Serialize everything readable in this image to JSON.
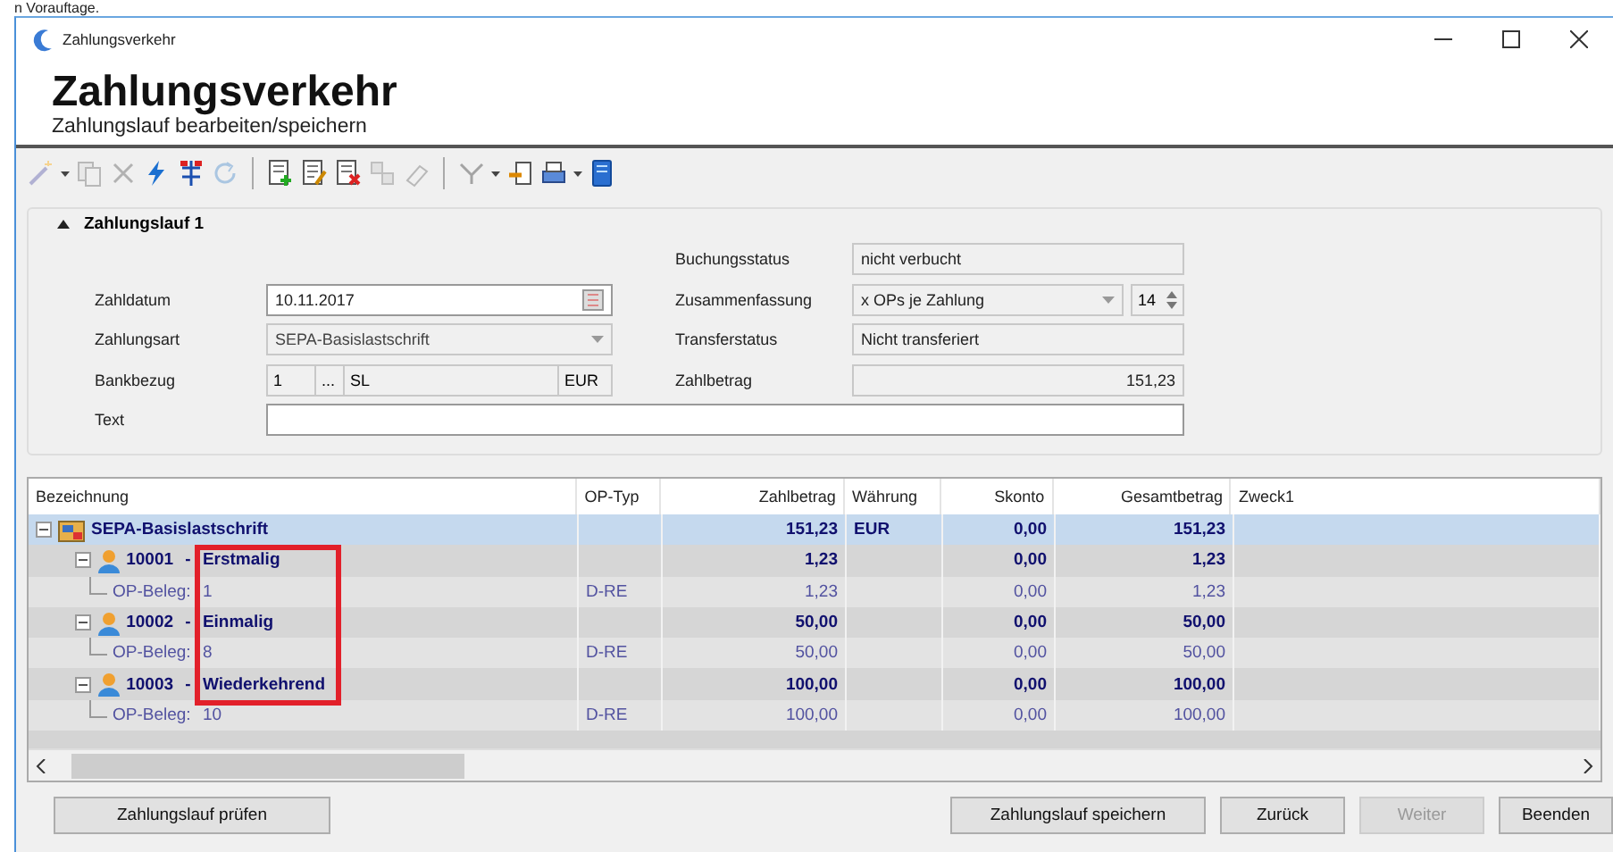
{
  "above_text": "n Vorauftage.",
  "window": {
    "title": "Zahlungsverkehr"
  },
  "header": {
    "title": "Zahlungsverkehr",
    "subtitle": "Zahlungslauf bearbeiten/speichern"
  },
  "toolbar": [
    {
      "kind": "wand",
      "disabled": true,
      "dropdown": true
    },
    {
      "kind": "copy",
      "disabled": true
    },
    {
      "kind": "cross",
      "disabled": true
    },
    {
      "kind": "bolt",
      "disabled": false
    },
    {
      "kind": "split",
      "disabled": false
    },
    {
      "kind": "refresh",
      "disabled": true
    },
    {
      "kind": "separator"
    },
    {
      "kind": "add",
      "disabled": false
    },
    {
      "kind": "edit",
      "disabled": false
    },
    {
      "kind": "remove",
      "disabled": false
    },
    {
      "kind": "link",
      "disabled": true
    },
    {
      "kind": "eraser",
      "disabled": true
    },
    {
      "kind": "separator"
    },
    {
      "kind": "filter",
      "disabled": true,
      "dropdown": true
    },
    {
      "kind": "export",
      "disabled": false
    },
    {
      "kind": "print",
      "disabled": false,
      "dropdown": true
    },
    {
      "kind": "book",
      "disabled": false
    }
  ],
  "group": {
    "title": "Zahlungslauf 1",
    "expanded": true,
    "left_fields": [
      {
        "kind": "date",
        "label": "Zahldatum",
        "value": "10.11.2017"
      },
      {
        "kind": "combo",
        "label": "Zahlungsart",
        "value": "SEPA-Basislastschrift",
        "disabled": true
      },
      {
        "kind": "bank",
        "label": "Bankbezug",
        "number": "1",
        "button": "...",
        "code": "SL",
        "currency": "EUR"
      },
      {
        "kind": "text",
        "label": "Text"
      }
    ],
    "right_fields": [
      {
        "kind": "readonly",
        "label": "Buchungsstatus",
        "value": "nicht verbucht"
      },
      {
        "kind": "combo_spin",
        "label": "Zusammenfassung",
        "value": "x OPs je Zahlung",
        "count": "14"
      },
      {
        "kind": "readonly",
        "label": "Transferstatus",
        "value": "Nicht transferiert"
      },
      {
        "kind": "amount",
        "label": "Zahlbetrag",
        "value": "151,23"
      }
    ]
  },
  "table": {
    "columns": [
      "Bezeichnung",
      "OP-Typ",
      "Zahlbetrag",
      "Währung",
      "Skonto",
      "Gesamtbetrag",
      "Zweck1"
    ],
    "rows": [
      {
        "kind": "payment_type",
        "label": "SEPA-Basislastschrift",
        "zahlbetrag": "151,23",
        "waehrung": "EUR",
        "skonto": "0,00",
        "gesamtbetrag": "151,23",
        "selected": true,
        "expanded": true,
        "children": [
          {
            "kind": "debtor",
            "label": "10001 - Erstmalig",
            "zahlbetrag": "1,23",
            "skonto": "0,00",
            "gesamtbetrag": "1,23",
            "selected": false,
            "expanded": true,
            "children": [
              {
                "kind": "document",
                "label": "OP-Beleg: 1",
                "op_typ": "D-RE",
                "zahlbetrag": "1,23",
                "skonto": "0,00",
                "gesamtbetrag": "1,23",
                "selected": false
              }
            ]
          },
          {
            "kind": "debtor",
            "label": "10002 - Einmalig",
            "zahlbetrag": "50,00",
            "skonto": "0,00",
            "gesamtbetrag": "50,00",
            "selected": false,
            "expanded": true,
            "children": [
              {
                "kind": "document",
                "label": "OP-Beleg: 8",
                "op_typ": "D-RE",
                "zahlbetrag": "50,00",
                "skonto": "0,00",
                "gesamtbetrag": "50,00",
                "selected": false
              }
            ]
          },
          {
            "kind": "debtor",
            "label": "10003 - Wiederkehrend",
            "zahlbetrag": "100,00",
            "skonto": "0,00",
            "gesamtbetrag": "100,00",
            "selected": false,
            "expanded": true,
            "children": [
              {
                "kind": "document",
                "label": "OP-Beleg: 10",
                "op_typ": "D-RE",
                "zahlbetrag": "100,00",
                "skonto": "0,00",
                "gesamtbetrag": "100,00",
                "selected": false
              }
            ]
          }
        ]
      }
    ]
  },
  "buttons": [
    {
      "label": "Zahlungslauf prüfen",
      "disabled": false
    },
    {
      "label": "Zahlungslauf speichern",
      "disabled": false
    },
    {
      "label": "Zurück",
      "disabled": false
    },
    {
      "label": "Weiter",
      "disabled": true
    },
    {
      "label": "Beenden",
      "disabled": false
    }
  ]
}
